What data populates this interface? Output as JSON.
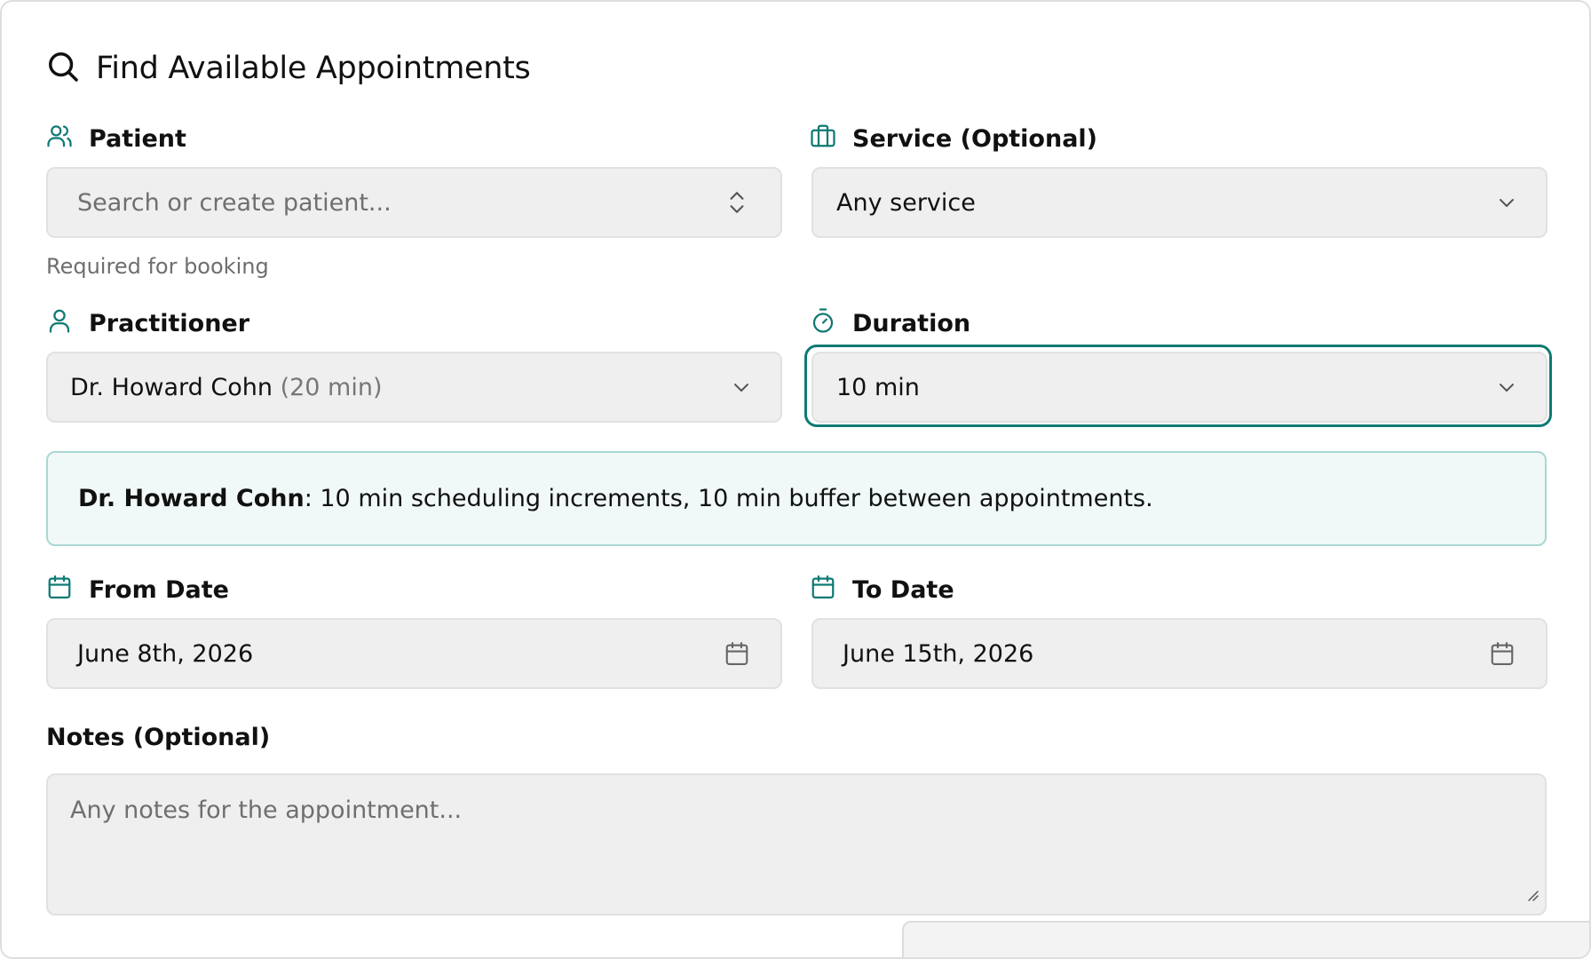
{
  "header": {
    "title": "Find Available Appointments",
    "icon": "search-icon"
  },
  "patient": {
    "label": "Patient",
    "placeholder": "Search or create patient...",
    "helper": "Required for booking",
    "icon": "users-icon"
  },
  "service": {
    "label": "Service (Optional)",
    "value": "Any service",
    "icon": "briefcase-icon"
  },
  "practitioner": {
    "label": "Practitioner",
    "value_name": "Dr. Howard Cohn",
    "value_suffix": "(20 min)",
    "icon": "user-icon"
  },
  "duration": {
    "label": "Duration",
    "value": "10 min",
    "icon": "timer-icon"
  },
  "info": {
    "name": "Dr. Howard Cohn",
    "text": ": 10 min scheduling increments, 10 min buffer between appointments."
  },
  "from_date": {
    "label": "From Date",
    "value": "June 8th, 2026",
    "icon": "calendar-icon"
  },
  "to_date": {
    "label": "To Date",
    "value": "June 15th, 2026",
    "icon": "calendar-icon"
  },
  "notes": {
    "label": "Notes (Optional)",
    "placeholder": "Any notes for the appointment..."
  },
  "colors": {
    "accent": "#0f7a73",
    "field_bg": "#efefef",
    "info_bg": "#f0f9f8",
    "info_border": "#a8d7d2"
  }
}
